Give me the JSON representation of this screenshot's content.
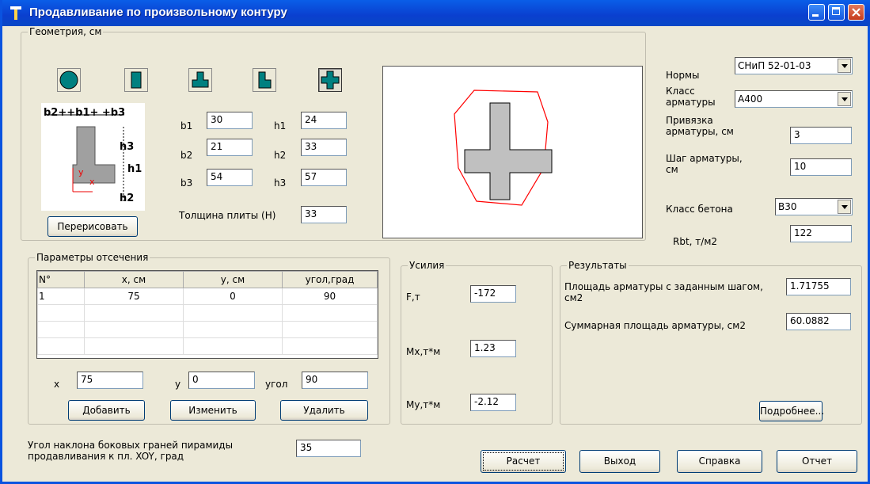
{
  "window": {
    "title": "Продавливание по произвольному контуру"
  },
  "geometry": {
    "legend": "Геометрия, см",
    "shapes": [
      "circle-icon",
      "rectangle-icon",
      "t-shape-icon",
      "l-shape-icon",
      "cross-shape-icon"
    ],
    "fields": {
      "b1": {
        "label": "b1",
        "value": "30"
      },
      "b2": {
        "label": "b2",
        "value": "21"
      },
      "b3": {
        "label": "b3",
        "value": "54"
      },
      "h1": {
        "label": "h1",
        "value": "24"
      },
      "h2": {
        "label": "h2",
        "value": "33"
      },
      "h3": {
        "label": "h3",
        "value": "57"
      }
    },
    "thickness_label": "Толщина плиты (H)",
    "thickness_value": "33",
    "redraw_label": "Перерисовать",
    "diagram_labels": {
      "top": "b2++b1+ +b3",
      "h3": "h3",
      "h1": "h1",
      "h2": "h2",
      "y": "y",
      "x": "x"
    }
  },
  "settings": {
    "norms_label": "Нормы",
    "norms_value": "СНиП 52-01-03",
    "rebar_class_label": "Класс арматуры",
    "rebar_class_value": "A400",
    "rebar_offset_label": "Привязка арматуры, см",
    "rebar_offset_value": "3",
    "rebar_step_label": "Шаг арматуры, см",
    "rebar_step_value": "10",
    "concrete_class_label": "Класс бетона",
    "concrete_class_value": "B30",
    "rbt_label": "Rbt, т/м2",
    "rbt_value": "122"
  },
  "cutoff": {
    "legend": "Параметры отсечения",
    "columns": [
      "N°",
      "x, см",
      "y, см",
      "угол,град"
    ],
    "rows": [
      [
        "1",
        "75",
        "0",
        "90"
      ]
    ],
    "x_label": "x",
    "x_value": "75",
    "y_label": "y",
    "y_value": "0",
    "angle_label": "угол",
    "angle_value": "90",
    "add_label": "Добавить",
    "edit_label": "Изменить",
    "delete_label": "Удалить"
  },
  "forces": {
    "legend": "Усилия",
    "f_label": "F,т",
    "f_value": "-172",
    "mx_label": "Mx,т*м",
    "mx_value": "1.23",
    "my_label": "My,т*м",
    "my_value": "-2.12"
  },
  "results": {
    "legend": "Результаты",
    "area_step_label": "Площадь арматуры с заданным шагом, см2",
    "area_step_value": "1.71755",
    "area_total_label": "Суммарная площадь арматуры, см2",
    "area_total_value": "60.0882",
    "more_label": "Подробнее..."
  },
  "bottom": {
    "angle_label": "Угол наклона боковых граней пирамиды продавливания к пл. XOY, град",
    "angle_value": "35",
    "calc_label": "Расчет",
    "exit_label": "Выход",
    "help_label": "Справка",
    "report_label": "Отчет"
  },
  "colors": {
    "titlebar": "#0a3fcf",
    "contour": "#ff0000",
    "section_fill": "#c0c0c0",
    "shape_icon": "#008080"
  }
}
